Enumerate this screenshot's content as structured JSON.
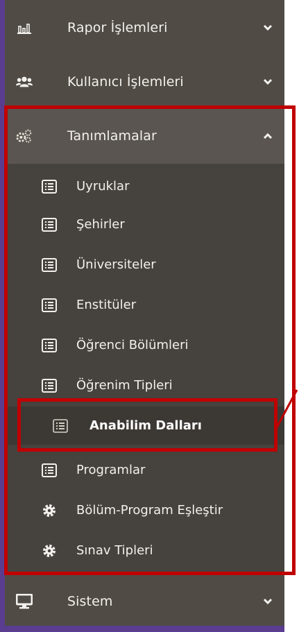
{
  "menu": {
    "rapor": {
      "label": "Rapor İşlemleri",
      "icon": "bar-chart-icon"
    },
    "kullanici": {
      "label": "Kullanıcı İşlemleri",
      "icon": "users-icon"
    },
    "tanimlamalar": {
      "label": "Tanımlamalar",
      "icon": "cogs-icon",
      "expanded": true
    },
    "sistem": {
      "label": "Sistem",
      "icon": "monitor-icon"
    }
  },
  "submenu": [
    {
      "label": "Uyruklar",
      "icon": "list-icon"
    },
    {
      "label": "Şehirler",
      "icon": "list-icon"
    },
    {
      "label": "Üniversiteler",
      "icon": "list-icon"
    },
    {
      "label": "Enstitüler",
      "icon": "list-icon"
    },
    {
      "label": "Öğrenci Bölümleri",
      "icon": "list-icon"
    },
    {
      "label": "Öğrenim Tipleri",
      "icon": "list-icon"
    },
    {
      "label": "Anabilim Dalları",
      "icon": "list-icon",
      "active": true
    },
    {
      "label": "Programlar",
      "icon": "list-icon"
    },
    {
      "label": "Bölüm-Program Eşleştir",
      "icon": "gear-icon"
    },
    {
      "label": "Sınav Tipleri",
      "icon": "gear-icon"
    }
  ],
  "colors": {
    "sidebar_bg": "#504b45",
    "submenu_bg": "#46423d",
    "active_bg": "#3c3934",
    "accent_purple": "#5a3d8f",
    "highlight_red": "#c00000",
    "text": "#f3f1ee"
  }
}
